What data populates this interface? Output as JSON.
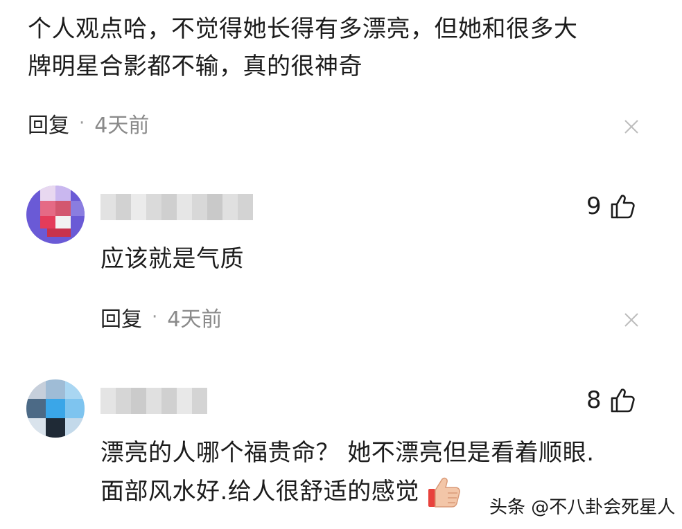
{
  "top_comment": {
    "line1": "个人观点哈，不觉得她长得有多漂亮，但她和很多大",
    "line2": "牌明星合影都不输，真的很神奇",
    "reply_label": "回复",
    "separator": "·",
    "time": "4天前"
  },
  "replies": [
    {
      "likes": "9",
      "text": "应该就是气质",
      "reply_label": "回复",
      "separator": "·",
      "time": "4天前"
    },
    {
      "likes": "8",
      "line1": "漂亮的人哪个福贵命？ 她不漂亮但是看着顺眼.",
      "line2": "面部风水好.给人很舒适的感觉"
    }
  ],
  "watermark": "头条 @不八卦会死星人",
  "icons": {
    "close": "close-icon",
    "like": "thumbs-up-icon",
    "emoji": "thumbs-up-emoji"
  },
  "colors": {
    "text": "#1c1c1c",
    "muted": "#8a8a8a",
    "close": "#bdbdbd"
  }
}
